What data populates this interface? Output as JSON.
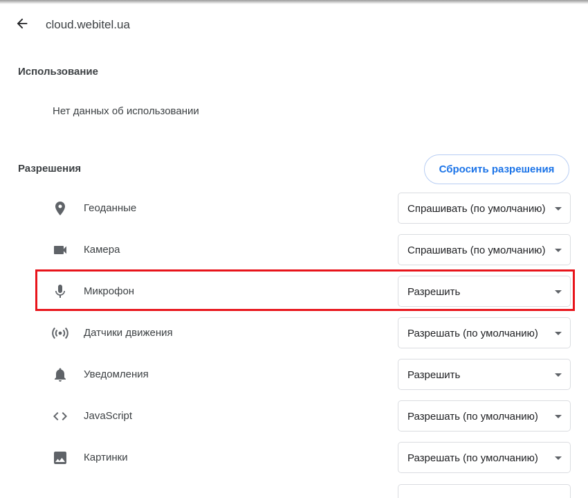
{
  "header": {
    "site": "cloud.webitel.ua"
  },
  "usage": {
    "title": "Использование",
    "text": "Нет данных об использовании"
  },
  "permissions": {
    "title": "Разрешения",
    "reset_label": "Сбросить разрешения",
    "items": [
      {
        "icon": "location-pin-icon",
        "label": "Геоданные",
        "value": "Спрашивать (по умолчанию)"
      },
      {
        "icon": "camera-icon",
        "label": "Камера",
        "value": "Спрашивать (по умолчанию)"
      },
      {
        "icon": "microphone-icon",
        "label": "Микрофон",
        "value": "Разрешить"
      },
      {
        "icon": "motion-sensors-icon",
        "label": "Датчики движения",
        "value": "Разрешать (по умолчанию)"
      },
      {
        "icon": "bell-icon",
        "label": "Уведомления",
        "value": "Разрешить"
      },
      {
        "icon": "code-icon",
        "label": "JavaScript",
        "value": "Разрешать (по умолчанию)"
      },
      {
        "icon": "image-icon",
        "label": "Картинки",
        "value": "Разрешать (по умолчанию)"
      }
    ]
  },
  "colors": {
    "accent": "#1a73e8",
    "highlight": "#e8141b",
    "icon": "#5f6368"
  }
}
